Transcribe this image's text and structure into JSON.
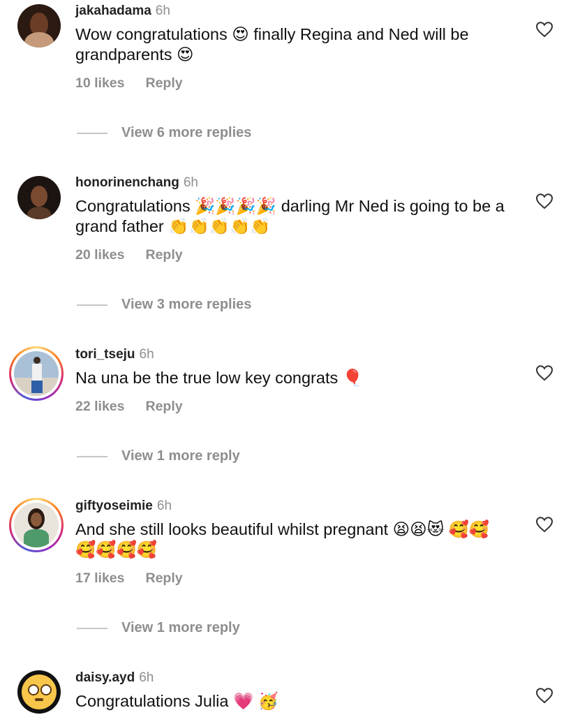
{
  "comments": [
    {
      "username": "jakahadama",
      "time": "6h",
      "text": "Wow congratulations 😍 finally Regina and Ned will be grandparents 😍",
      "likes": "10 likes",
      "reply": "Reply",
      "view_more": "View 6 more replies",
      "avatar_icon": "avatar"
    },
    {
      "username": "honorinenchang",
      "time": "6h",
      "text": "Congratulations 🎉🎉🎉🎉 darling Mr Ned is going to be a grand father 👏👏👏👏👏",
      "likes": "20 likes",
      "reply": "Reply",
      "view_more": "View 3 more replies",
      "avatar_icon": "avatar"
    },
    {
      "username": "tori_tseju",
      "time": "6h",
      "text": "Na una be the true low key congrats 🎈",
      "likes": "22 likes",
      "reply": "Reply",
      "view_more": "View 1 more reply",
      "avatar_icon": "avatar-story-ring"
    },
    {
      "username": "giftyoseimie",
      "time": "6h",
      "text": "And she still looks beautiful whilst pregnant 😫😫😻 🥰🥰🥰🥰🥰🥰",
      "likes": "17 likes",
      "reply": "Reply",
      "view_more": "View 1 more reply",
      "avatar_icon": "avatar-story-ring"
    },
    {
      "username": "daisy.ayd",
      "time": "6h",
      "text": "Congratulations Julia 💗 🥳",
      "avatar_icon": "flushed-face-emoji-avatar"
    }
  ],
  "colors": {
    "muted": "#8e8e8e",
    "text": "#111111",
    "story_ring": [
      "#feda75",
      "#fa7e1e",
      "#d62976",
      "#962fbf"
    ]
  },
  "icons": {
    "like": "heart-outline-icon"
  }
}
